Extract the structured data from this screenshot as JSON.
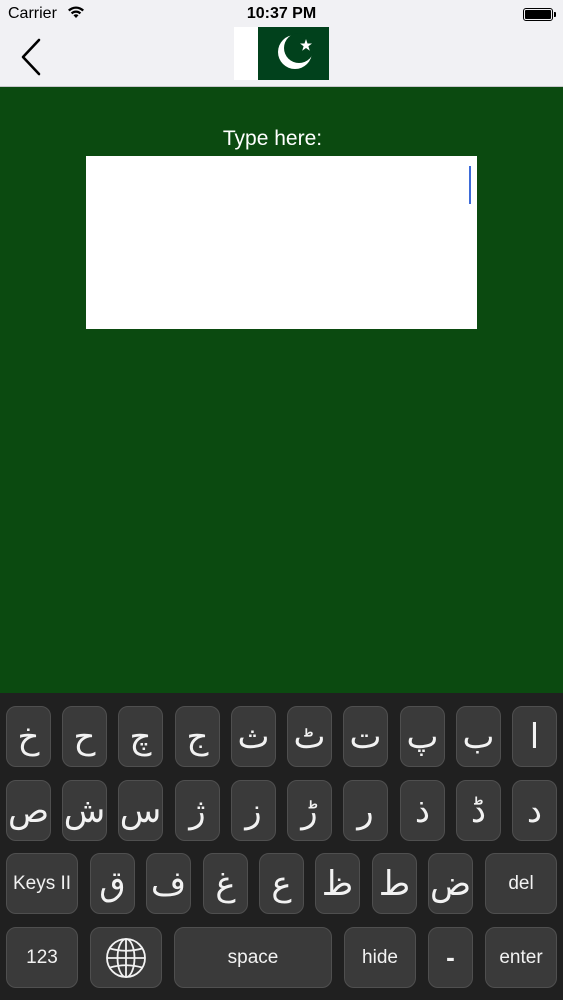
{
  "status_bar": {
    "carrier": "Carrier",
    "time": "10:37 PM",
    "wifi_icon": "wifi-icon",
    "battery_icon": "battery-icon"
  },
  "nav": {
    "back_icon": "chevron-left-icon",
    "flag": "pakistan-flag",
    "flag_colors": {
      "green": "#01411c",
      "white": "#ffffff"
    }
  },
  "content": {
    "prompt": "Type here:",
    "text_value": "",
    "background": "#0b4a10"
  },
  "keyboard": {
    "row1": [
      "خ",
      "ح",
      "چ",
      "ج",
      "ث",
      "ٹ",
      "ت",
      "پ",
      "ب",
      "ا"
    ],
    "row2": [
      "ص",
      "ش",
      "س",
      "ژ",
      "ز",
      "ڑ",
      "ر",
      "ذ",
      "ڈ",
      "د"
    ],
    "row3": {
      "keys_label": "Keys II",
      "letters": [
        "ق",
        "ف",
        "غ",
        "ع",
        "ظ",
        "ط",
        "ض"
      ],
      "delete_label": "del"
    },
    "row4": {
      "numbers_label": "123",
      "globe_icon": "globe-icon",
      "space_label": "space",
      "hide_label": "hide",
      "dash_label": "-",
      "enter_label": "enter"
    }
  }
}
